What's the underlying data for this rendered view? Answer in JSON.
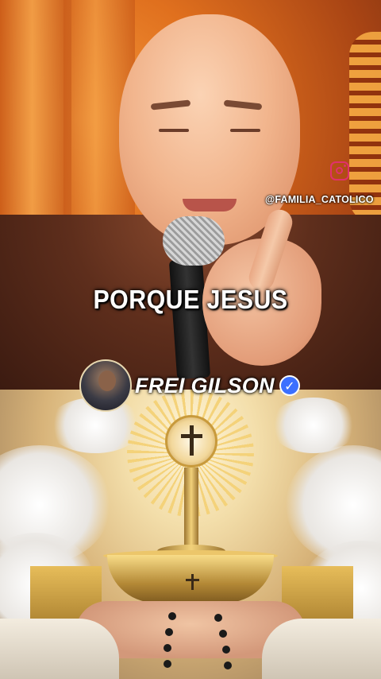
{
  "overlay": {
    "instagram_handle": "@FAMILIA_CATOLICO",
    "caption": "PORQUE JESUS"
  },
  "profile": {
    "name": "FREI GILSON",
    "verified_icon": "check-icon"
  },
  "colors": {
    "instagram": "#e1306c",
    "verified": "#3c70ff",
    "caption_text": "#ffffff"
  }
}
